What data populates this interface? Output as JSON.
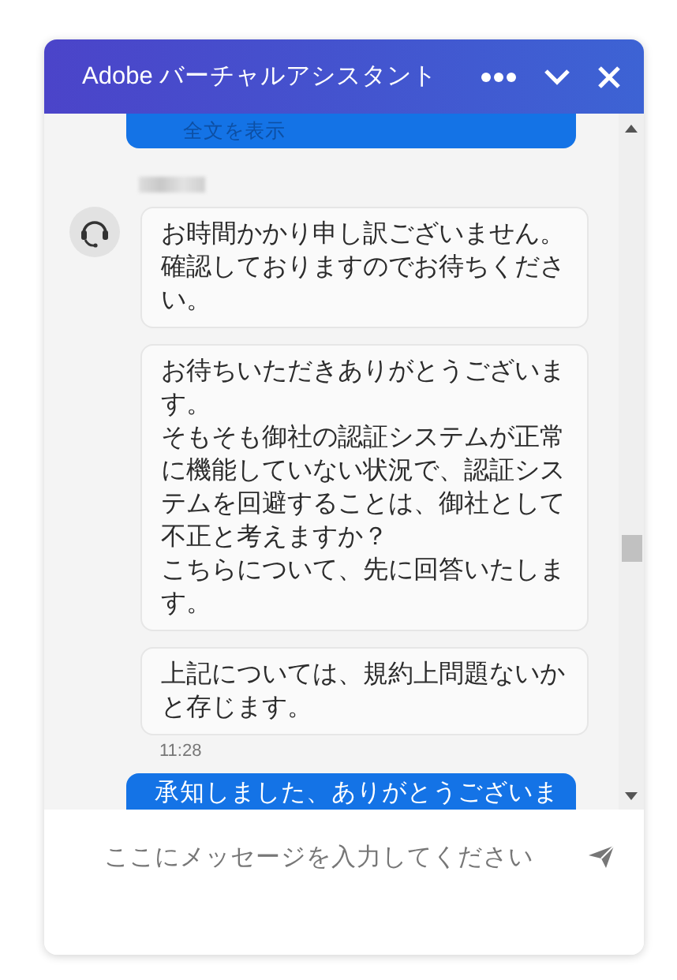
{
  "header": {
    "title": "Adobe バーチャルアシスタント"
  },
  "messages": [
    {
      "kind": "user",
      "link": "全文を表示"
    },
    {
      "kind": "agent",
      "avatar": true,
      "text": "お時間かかり申し訳ございません。確認しておりますのでお待ちください。"
    },
    {
      "kind": "agent",
      "avatar": false,
      "lines": [
        "お待ちいただきありがとうございます。",
        "そもそも御社の認証システムが正常に機能していない状況で、認証システムを回避することは、御社として不正と考えますか？",
        "こちらについて、先に回答いたします。"
      ]
    },
    {
      "kind": "agent",
      "avatar": false,
      "text": "上記については、規約上問題ないかと存じます。",
      "time": "11:28"
    },
    {
      "kind": "user",
      "text": "承知しました、ありがとうございま"
    }
  ],
  "composer": {
    "placeholder": "ここにメッセージを入力してください"
  }
}
